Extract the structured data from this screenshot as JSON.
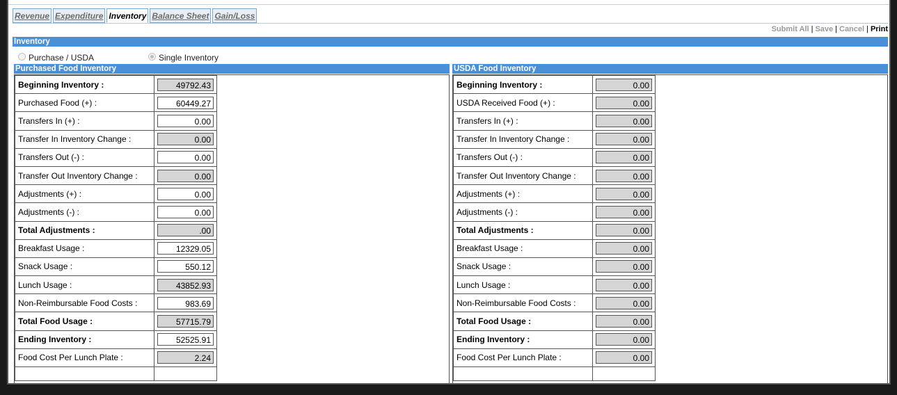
{
  "tabs": [
    {
      "label": "Revenue",
      "active": false
    },
    {
      "label": "Expenditure",
      "active": false
    },
    {
      "label": "Inventory",
      "active": true
    },
    {
      "label": "Balance Sheet",
      "active": false
    },
    {
      "label": "Gain/Loss",
      "active": false
    }
  ],
  "actions": {
    "submit_all": "Submit All",
    "save": "Save",
    "cancel": "Cancel",
    "print": "Print",
    "separator": "|"
  },
  "section_title": "Inventory",
  "radio_options": {
    "purchase_usda": {
      "label": "Purchase / USDA",
      "selected": false
    },
    "single_inventory": {
      "label": "Single Inventory",
      "selected": true
    }
  },
  "purchased": {
    "title": "Purchased Food Inventory",
    "rows": [
      {
        "label": "Beginning Inventory :",
        "value": "49792.43"
      },
      {
        "label": "Purchased Food (+) :",
        "value": "60449.27"
      },
      {
        "label": "Transfers In (+) :",
        "value": "0.00"
      },
      {
        "label": "Transfer In Inventory Change :",
        "value": "0.00"
      },
      {
        "label": "Transfers Out (-) :",
        "value": "0.00"
      },
      {
        "label": "Transfer Out Inventory Change :",
        "value": "0.00"
      },
      {
        "label": "Adjustments (+) :",
        "value": "0.00"
      },
      {
        "label": "Adjustments (-) :",
        "value": "0.00"
      },
      {
        "label": "Total Adjustments :",
        "value": ".00"
      },
      {
        "label": "Breakfast Usage :",
        "value": "12329.05"
      },
      {
        "label": "Snack Usage :",
        "value": "550.12"
      },
      {
        "label": "Lunch Usage :",
        "value": "43852.93"
      },
      {
        "label": "Non-Reimbursable Food Costs :",
        "value": "983.69"
      },
      {
        "label": "Total Food Usage :",
        "value": "57715.79"
      },
      {
        "label": "Ending Inventory :",
        "value": "52525.91"
      },
      {
        "label": "Food Cost Per Lunch Plate :",
        "value": "2.24"
      }
    ]
  },
  "usda": {
    "title": "USDA Food Inventory",
    "rows": [
      {
        "label": "Beginning Inventory :",
        "value": "0.00"
      },
      {
        "label": "USDA Received Food (+) :",
        "value": "0.00"
      },
      {
        "label": "Transfers In (+) :",
        "value": "0.00"
      },
      {
        "label": "Transfer In Inventory Change :",
        "value": "0.00"
      },
      {
        "label": "Transfers Out (-) :",
        "value": "0.00"
      },
      {
        "label": "Transfer Out Inventory Change :",
        "value": "0.00"
      },
      {
        "label": "Adjustments (+) :",
        "value": "0.00"
      },
      {
        "label": "Adjustments (-) :",
        "value": "0.00"
      },
      {
        "label": "Total Adjustments :",
        "value": "0.00"
      },
      {
        "label": "Breakfast Usage :",
        "value": "0.00"
      },
      {
        "label": "Snack Usage :",
        "value": "0.00"
      },
      {
        "label": "Lunch Usage :",
        "value": "0.00"
      },
      {
        "label": "Non-Reimbursable Food Costs :",
        "value": "0.00"
      },
      {
        "label": "Total Food Usage :",
        "value": "0.00"
      },
      {
        "label": "Ending Inventory :",
        "value": "0.00"
      },
      {
        "label": "Food Cost Per Lunch Plate :",
        "value": "0.00"
      }
    ]
  }
}
